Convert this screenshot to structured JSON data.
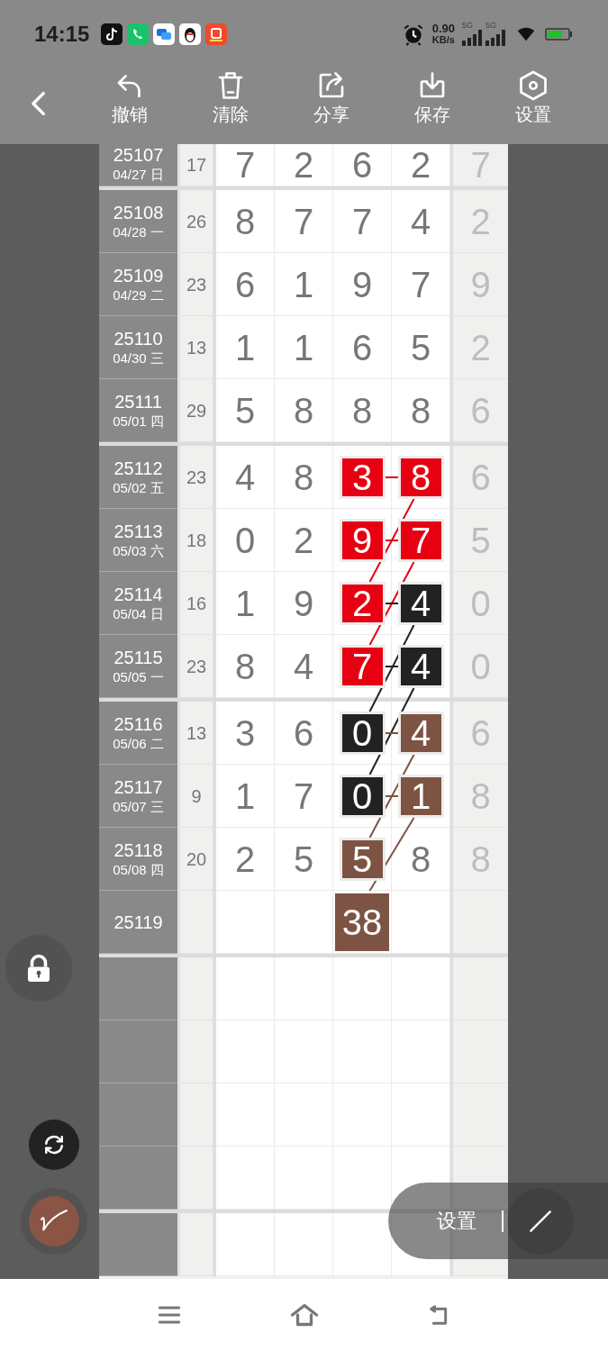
{
  "status_bar": {
    "time": "14:15",
    "apps": [
      {
        "kind": "tiktok"
      },
      {
        "kind": "phone"
      },
      {
        "kind": "chat"
      },
      {
        "kind": "penguin"
      },
      {
        "kind": "shop"
      }
    ],
    "network_speed": "0.90",
    "network_unit": "KB/s",
    "sim_labels": [
      "5G",
      "5G"
    ]
  },
  "toolbar": {
    "buttons": [
      {
        "label": "撤销",
        "kind": "undo"
      },
      {
        "label": "清除",
        "kind": "clear"
      },
      {
        "label": "分享",
        "kind": "share"
      },
      {
        "label": "保存",
        "kind": "save"
      },
      {
        "label": "设置",
        "kind": "settings"
      }
    ]
  },
  "table": {
    "groups": [
      {
        "rows": [
          {
            "issue": "25107",
            "date": "04/27 日",
            "sum": "17",
            "digits": [
              {
                "text": "7"
              },
              {
                "text": "2"
              },
              {
                "text": "6"
              },
              {
                "text": "2"
              }
            ],
            "column_7": "7"
          }
        ]
      },
      {
        "rows": [
          {
            "issue": "25108",
            "date": "04/28 一",
            "sum": "26",
            "digits": [
              {
                "text": "8"
              },
              {
                "text": "7"
              },
              {
                "text": "7"
              },
              {
                "text": "4"
              }
            ],
            "column_7": "2"
          },
          {
            "issue": "25109",
            "date": "04/29 二",
            "sum": "23",
            "digits": [
              {
                "text": "6"
              },
              {
                "text": "1"
              },
              {
                "text": "9"
              },
              {
                "text": "7"
              }
            ],
            "column_7": "9"
          },
          {
            "issue": "25110",
            "date": "04/30 三",
            "sum": "13",
            "digits": [
              {
                "text": "1"
              },
              {
                "text": "1"
              },
              {
                "text": "6"
              },
              {
                "text": "5"
              }
            ],
            "column_7": "2"
          },
          {
            "issue": "25111",
            "date": "05/01 四",
            "sum": "29",
            "digits": [
              {
                "text": "5"
              },
              {
                "text": "8"
              },
              {
                "text": "8"
              },
              {
                "text": "8"
              }
            ],
            "column_7": "6"
          }
        ]
      },
      {
        "rows": [
          {
            "issue": "25112",
            "date": "05/02 五",
            "sum": "23",
            "digits": [
              {
                "text": "4"
              },
              {
                "text": "8"
              },
              {
                "text": "3",
                "color": "#e60012"
              },
              {
                "text": "8",
                "color": "#e60012"
              }
            ],
            "column_7": "6"
          },
          {
            "issue": "25113",
            "date": "05/03 六",
            "sum": "18",
            "digits": [
              {
                "text": "0"
              },
              {
                "text": "2"
              },
              {
                "text": "9",
                "color": "#e60012"
              },
              {
                "text": "7",
                "color": "#e60012"
              }
            ],
            "column_7": "5"
          },
          {
            "issue": "25114",
            "date": "05/04 日",
            "sum": "16",
            "digits": [
              {
                "text": "1"
              },
              {
                "text": "9"
              },
              {
                "text": "2",
                "color": "#e60012"
              },
              {
                "text": "4",
                "color": "#222222"
              }
            ],
            "column_7": "0"
          },
          {
            "issue": "25115",
            "date": "05/05 一",
            "sum": "23",
            "digits": [
              {
                "text": "8"
              },
              {
                "text": "4"
              },
              {
                "text": "7",
                "color": "#e60012"
              },
              {
                "text": "4",
                "color": "#222222"
              }
            ],
            "column_7": "0"
          }
        ]
      },
      {
        "rows": [
          {
            "issue": "25116",
            "date": "05/06 二",
            "sum": "13",
            "digits": [
              {
                "text": "3"
              },
              {
                "text": "6"
              },
              {
                "text": "0",
                "color": "#222222"
              },
              {
                "text": "4",
                "color": "#7d5443"
              }
            ],
            "column_7": "6"
          },
          {
            "issue": "25117",
            "date": "05/07 三",
            "sum": "9",
            "digits": [
              {
                "text": "1"
              },
              {
                "text": "7"
              },
              {
                "text": "0",
                "color": "#222222"
              },
              {
                "text": "1",
                "color": "#7d5443"
              }
            ],
            "column_7": "8"
          },
          {
            "issue": "25118",
            "date": "05/08 四",
            "sum": "20",
            "digits": [
              {
                "text": "2"
              },
              {
                "text": "5"
              },
              {
                "text": "5",
                "color": "#7d5443"
              },
              {
                "text": "8"
              }
            ],
            "column_7": "8"
          },
          {
            "issue": "25119",
            "forecast": {
              "text": "38",
              "color": "#7d5443"
            }
          }
        ]
      }
    ]
  },
  "floating_toolbar": {
    "label": "设置"
  }
}
